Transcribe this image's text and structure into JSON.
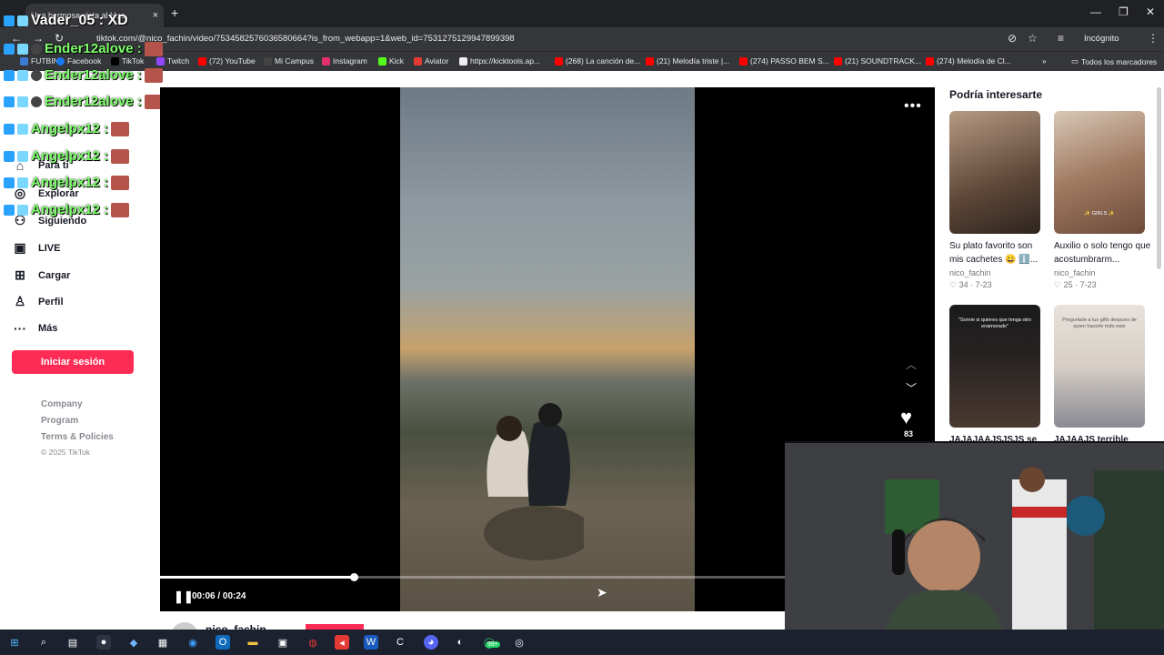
{
  "browser": {
    "tab_title": "Una hermosa vista al Hua",
    "tab_close": "×",
    "new_tab": "+",
    "url": "tiktok.com/@nico_fachin/video/7534582576036580664?is_from_webapp=1&web_id=7531275129947899398",
    "incognito_label": "Incógnito",
    "bookmarks": [
      "FUTBIN",
      "Facebook",
      "TikTok",
      "Twitch",
      "(72) YouTube",
      "Mi Campus",
      "Instagram",
      "Kick",
      "Aviator",
      "https://kicktools.ap...",
      "(268) La canción de...",
      "(21) Melodía triste |...",
      "(274) PASSO BEM S...",
      "(21) SOUNDTRACK...",
      "(274) Melodía de Cl..."
    ],
    "all_bookmarks": "Todos los marcadores",
    "overflow": "»"
  },
  "sidebar": {
    "nav": [
      {
        "label": "Para ti",
        "icon": "home-icon"
      },
      {
        "label": "Explorar",
        "icon": "compass-icon"
      },
      {
        "label": "Siguiendo",
        "icon": "following-icon"
      },
      {
        "label": "LIVE",
        "icon": "live-icon"
      },
      {
        "label": "Cargar",
        "icon": "upload-icon"
      },
      {
        "label": "Perfil",
        "icon": "profile-icon"
      },
      {
        "label": "Más",
        "icon": "more-icon"
      }
    ],
    "login_button": "Iniciar sesión",
    "footer": [
      "Company",
      "Program",
      "Terms & Policies"
    ],
    "copyright": "© 2025 TikTok"
  },
  "chat_overlay": [
    {
      "text": "Vader_05 : XD",
      "color": "#ffffff"
    },
    {
      "text": "Ender12alove :",
      "color": "#7dff6b"
    },
    {
      "text": "Ender12alove :",
      "color": "#7dff6b"
    },
    {
      "text": "Ender12alove :",
      "color": "#7dff6b"
    },
    {
      "text": "Angelpx12 :",
      "color": "#7dff6b"
    },
    {
      "text": "Angelpx12 :",
      "color": "#7dff6b"
    },
    {
      "text": "Angelpx12 :",
      "color": "#7dff6b"
    },
    {
      "text": "Angelpx12 :",
      "color": "#7dff6b"
    }
  ],
  "video": {
    "more_icon": "•••",
    "likes": "83",
    "current_time": "00:06",
    "duration": "00:24",
    "time_label": "00:06 / 00:24",
    "progress": 0.25,
    "author": "nico_fachin"
  },
  "recommendations": {
    "title": "Podría interesarte",
    "items": [
      {
        "text": "Su plato favorito son mis cachetes 😀 ℹ️...",
        "author": "nico_fachin",
        "likes": "34",
        "date": "7-23",
        "caption": ""
      },
      {
        "text": "Auxilio o solo tengo que acostumbrarm...",
        "author": "nico_fachin",
        "likes": "25",
        "date": "7-23",
        "caption": "✨ GIRLS ✨"
      },
      {
        "text": "JAJAJAAJSJSJS se",
        "author": "",
        "likes": "",
        "date": "",
        "caption": "\"Sonrie si quieres que tenga otro enamorado\""
      },
      {
        "text": "JAJAAJS terrible",
        "author": "",
        "likes": "",
        "date": "",
        "caption": "Preguntale a tus gifts despues de quien hacerle todo este"
      }
    ]
  },
  "colors": {
    "accent": "#fe2c55",
    "chat_green": "#7dff6b",
    "taskbar": "#1c2130"
  },
  "taskbar": {
    "badge": "99+"
  }
}
